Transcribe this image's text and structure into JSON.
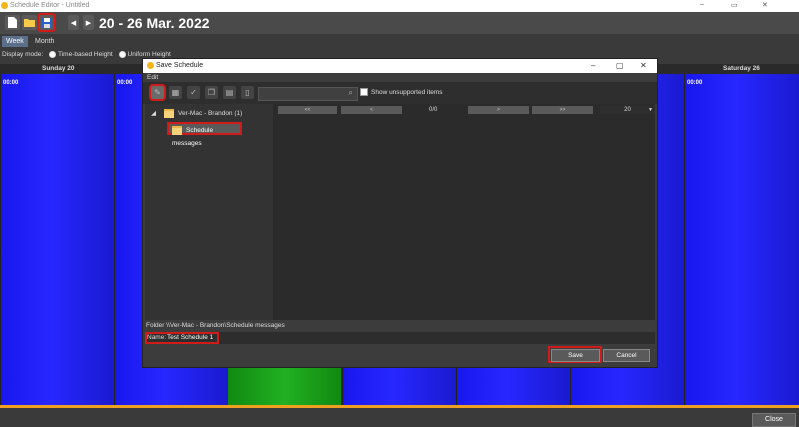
{
  "window": {
    "title": "Schedule Editor - Untitled",
    "minimize": "–",
    "maximize": "▭",
    "close": "✕"
  },
  "toolbar": {
    "date_range": "20 - 26 Mar. 2022",
    "prev": "◀",
    "next": "▶"
  },
  "tabs": [
    {
      "label": "Week"
    },
    {
      "label": "Month"
    }
  ],
  "display_mode": {
    "label": "Display mode:",
    "options": [
      {
        "label": "Time-based Height"
      },
      {
        "label": "Uniform Height"
      }
    ]
  },
  "days": {
    "sunday": "Sunday 20",
    "saturday": "Saturday 26"
  },
  "time_label": "00:00",
  "footer": {
    "close_label": "Close"
  },
  "dialog": {
    "title": "Save Schedule",
    "menu": "Edit",
    "show_unsupported": "Show unsupported items",
    "tree": {
      "root": "Ver-Mac - Brandon (1)",
      "child": "Schedule messages"
    },
    "pager": {
      "first": "<<",
      "prev": "<",
      "count": "0/0",
      "next": ">",
      "last": ">>",
      "page_size": "20"
    },
    "folder_path": "Folder \\\\Ver-Mac - Brandon\\Schedule messages",
    "name_label": "Name:",
    "name_value": "Test Schedule 1",
    "save_label": "Save",
    "cancel_label": "Cancel",
    "minimize": "–",
    "maximize": "▢",
    "close": "✕"
  },
  "colors": {
    "accent_highlight": "#d11a1a",
    "calendar_blue": "#2020ff",
    "event_green": "#1a9a1a",
    "orange_bar": "#f0a020"
  }
}
